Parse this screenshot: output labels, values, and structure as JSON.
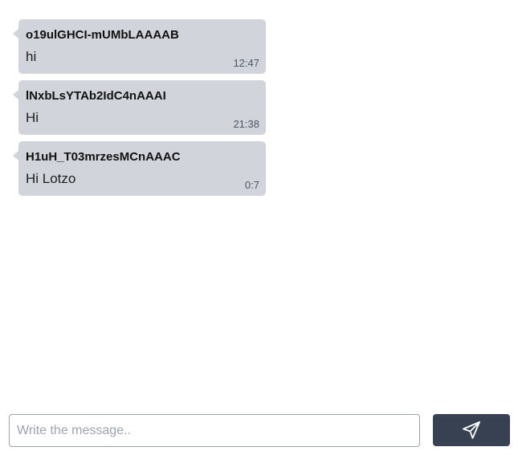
{
  "messages": [
    {
      "sender": "o19ulGHCI-mUMbLAAAAB",
      "text": "hi",
      "time": "12:47"
    },
    {
      "sender": "lNxbLsYTAb2IdC4nAAAI",
      "text": "Hi",
      "time": "21:38"
    },
    {
      "sender": "H1uH_T03mrzesMCnAAAC",
      "text": "Hi Lotzo",
      "time": "0:7"
    }
  ],
  "composer": {
    "placeholder": "Write the message..",
    "value": "",
    "send_icon": "send-icon"
  },
  "colors": {
    "bubble": "#d1d5db",
    "send_button": "#374151"
  }
}
